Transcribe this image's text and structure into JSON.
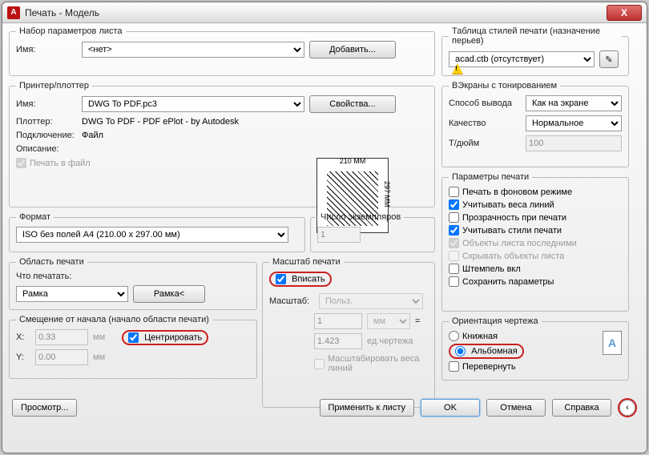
{
  "window": {
    "title": "Печать - Модель"
  },
  "pageSetup": {
    "legend": "Набор параметров листа",
    "nameLabel": "Имя:",
    "nameValue": "<нет>",
    "addBtn": "Добавить..."
  },
  "printer": {
    "legend": "Принтер/плоттер",
    "nameLabel": "Имя:",
    "nameValue": "DWG To PDF.pc3",
    "propsBtn": "Свойства...",
    "plotterLabel": "Плоттер:",
    "plotterValue": "DWG To PDF - PDF ePlot - by Autodesk",
    "connectLabel": "Подключение:",
    "connectValue": "Файл",
    "descLabel": "Описание:",
    "plotToFile": "Печать в файл"
  },
  "preview": {
    "top": "210 MM",
    "side": "297 MM"
  },
  "paperSize": {
    "legend": "Формат",
    "value": "ISO без полей A4 (210.00 x 297.00 мм)"
  },
  "copies": {
    "legend": "Число экземпляров",
    "value": "1"
  },
  "plotArea": {
    "legend": "Область печати",
    "whatLabel": "Что печатать:",
    "whatValue": "Рамка",
    "windowBtn": "Рамка<"
  },
  "offset": {
    "legend": "Смещение от начала (начало области печати)",
    "xLabel": "X:",
    "xValue": "0.33",
    "yLabel": "Y:",
    "yValue": "0.00",
    "unit": "мм",
    "centerLabel": "Центрировать"
  },
  "plotScale": {
    "legend": "Масштаб печати",
    "fitLabel": "Вписать",
    "scaleLabel": "Масштаб:",
    "scaleValue": "Польз.",
    "num": "1",
    "unit": "мм",
    "eq": "=",
    "denom": "1.423",
    "unitDraw": "ед.чертежа",
    "scaleLW": "Масштабировать веса линий"
  },
  "plotStyle": {
    "legend": "Таблица стилей печати (назначение перьев)",
    "value": "acad.ctb (отсутствует)"
  },
  "shaded": {
    "legend": "ВЭкраны с тонированием",
    "methodLabel": "Способ вывода",
    "methodValue": "Как на экране",
    "qualityLabel": "Качество",
    "qualityValue": "Нормальное",
    "dpiLabel": "Т/дюйм",
    "dpiValue": "100"
  },
  "plotOptions": {
    "legend": "Параметры печати",
    "bg": "Печать в фоновом режиме",
    "lw": "Учитывать веса линий",
    "transp": "Прозрачность при печати",
    "styles": "Учитывать стили печати",
    "last": "Объекты листа последними",
    "hide": "Скрывать объекты листа",
    "stamp": "Штемпель вкл",
    "save": "Сохранить параметры"
  },
  "orient": {
    "legend": "Ориентация чертежа",
    "portrait": "Книжная",
    "landscape": "Альбомная",
    "upside": "Перевернуть"
  },
  "footer": {
    "preview": "Просмотр...",
    "apply": "Применить к листу",
    "ok": "OK",
    "cancel": "Отмена",
    "help": "Справка"
  }
}
